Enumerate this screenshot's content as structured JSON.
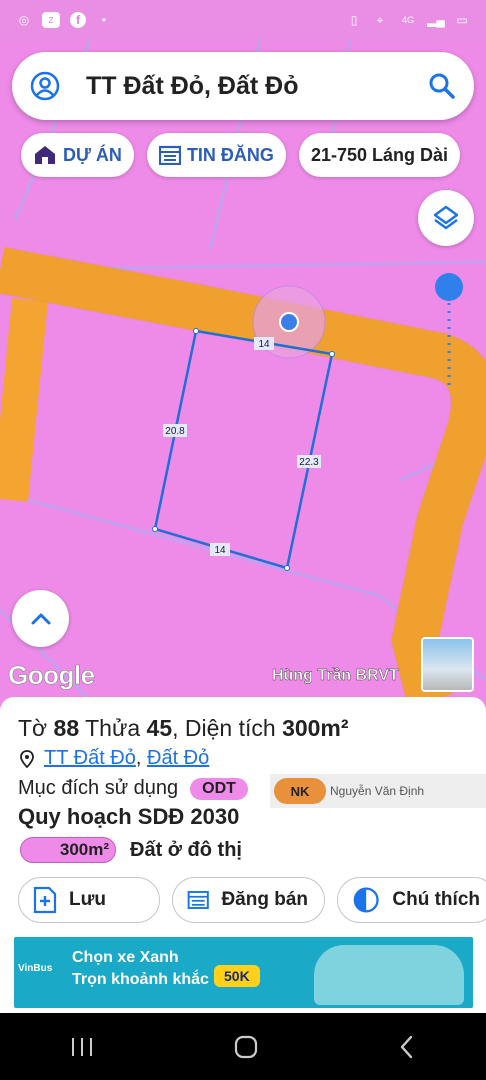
{
  "status_bar": {
    "icons_left": [
      "camera-icon",
      "zalo-icon",
      "facebook-icon",
      "dot-icon"
    ],
    "icons_right": [
      "battery-saver-icon",
      "location-icon",
      "network-4g-icon",
      "signal-icon",
      "battery-icon"
    ],
    "network_label": "4G"
  },
  "search": {
    "title": "TT Đất Đỏ, Đất Đỏ"
  },
  "chips": [
    {
      "label": "DỰ ÁN",
      "icon": "house-icon"
    },
    {
      "label": "TIN ĐĂNG",
      "icon": "calendar-icon"
    },
    {
      "label": "21-750 Láng Dài"
    }
  ],
  "map": {
    "plot_edges": [
      "14",
      "22.3",
      "14",
      "20.8"
    ],
    "google_label": "Google",
    "owner": "Hùng Trần BRVT"
  },
  "sheet": {
    "sheet_prefix": "Tờ",
    "sheet_no": "88",
    "plot_prefix": "Thửa",
    "plot_no": "45",
    "area_prefix": ", Diện tích",
    "area_value": "300m²",
    "location_1": "TT Đất Đỏ",
    "location_sep": ",",
    "location_2": "Đất Đỏ",
    "purpose_label": "Mục đích sử dụng",
    "purpose_code": "ODT",
    "ad_small": {
      "badge": "NK",
      "name": "Nguyễn Văn Định"
    },
    "plan_title": "Quy hoạch SDĐ 2030",
    "plan_area": "300m²",
    "plan_label": "Đất ở đô thị"
  },
  "actions": [
    {
      "label": "Lưu",
      "icon": "save-plus-icon"
    },
    {
      "label": "Đăng bán",
      "icon": "post-listing-icon"
    },
    {
      "label": "Chú thích",
      "icon": "legend-contrast-icon"
    }
  ],
  "ad_banner": {
    "line1": "Chọn xe Xanh",
    "line2": "Trọn khoảnh khắc",
    "price": "50K",
    "brand": "VinBus"
  },
  "colors": {
    "map_bg": "#ee8be9",
    "road": "#f4a431",
    "accent": "#1a73e8",
    "plot_line": "#1f6fd6"
  }
}
